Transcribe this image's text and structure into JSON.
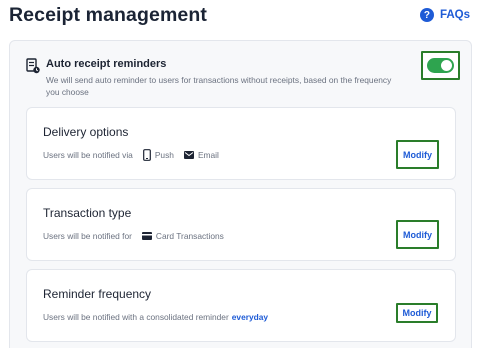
{
  "header": {
    "title": "Receipt management",
    "faq_label": "FAQs",
    "faq_icon": "help-circle-icon"
  },
  "auto_reminders": {
    "icon": "receipt-icon",
    "title": "Auto receipt reminders",
    "description": "We will send auto reminder to users for transactions without receipts, based on the frequency you choose",
    "toggle_state": "on"
  },
  "sections": [
    {
      "title": "Delivery options",
      "lead": "Users will be notified via",
      "options": [
        {
          "label": "Push",
          "icon": "phone-icon"
        },
        {
          "label": "Email",
          "icon": "mail-icon"
        }
      ],
      "button": "Modify"
    },
    {
      "title": "Transaction type",
      "lead": "Users will be notified for",
      "options": [
        {
          "label": "Card Transactions",
          "icon": "card-icon"
        }
      ],
      "button": "Modify"
    },
    {
      "title": "Reminder frequency",
      "lead": "Users will be notified with a consolidated reminder",
      "accent": "everyday",
      "button": "Modify"
    }
  ],
  "colors": {
    "accent_blue": "#1e5bd6",
    "toggle_green": "#2ea44f",
    "highlight_border": "#2a7d2a"
  }
}
